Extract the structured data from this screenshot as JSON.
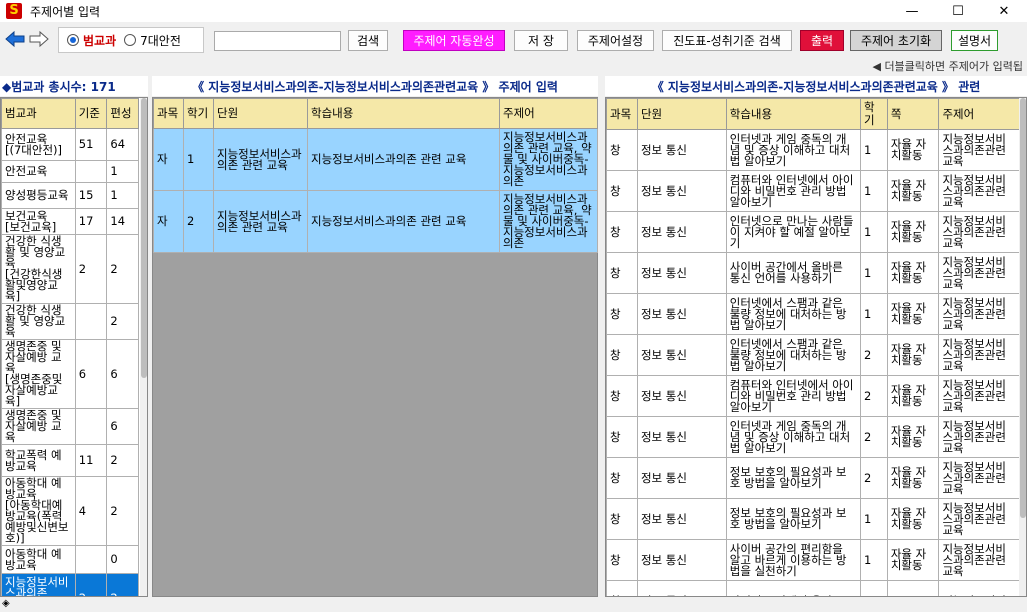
{
  "window": {
    "title": "주제어별 입력",
    "app_icon": "S"
  },
  "toolbar": {
    "radio_1": "범교과",
    "radio_2": "7대안전",
    "search_value": "",
    "search_btn": "검색",
    "auto_btn": "주제어 자동완성",
    "save_btn": "저 장",
    "settings_btn": "주제어설정",
    "progress_btn": "진도표-성취기준 검색",
    "print_btn": "출력",
    "reset_btn": "주제어 초기화",
    "manual_btn": "설명서"
  },
  "hint": "◀ 더블클릭하면 주제어가 입력됩",
  "left_panel": {
    "header": "◆범교과 총시수: 171",
    "columns": [
      "범교과",
      "기준",
      "편성"
    ],
    "rows": [
      {
        "name": "안전교육\n[(7대안전)]",
        "base": "51",
        "plan": "64"
      },
      {
        "name": "안전교육",
        "base": "",
        "plan": "1"
      },
      {
        "name": "양성평등교육",
        "base": "15",
        "plan": "1"
      },
      {
        "name": "보건교육\n[보건교육]",
        "base": "17",
        "plan": "14"
      },
      {
        "name": "건강한 식생활 및 영양교육\n[건강한식생활및영양교육]",
        "base": "2",
        "plan": "2"
      },
      {
        "name": "건강한 식생활 및 영양교육",
        "base": "",
        "plan": "2"
      },
      {
        "name": "생명존중 및 자살예방 교육\n[생명존중및자살예방교육]",
        "base": "6",
        "plan": "6"
      },
      {
        "name": "생명존중 및 자살예방 교육",
        "base": "",
        "plan": "6"
      },
      {
        "name": "학교폭력 예방교육",
        "base": "11",
        "plan": "2"
      },
      {
        "name": "아동학대 예방교육\n[아동학대예방교육(폭력예방및신변보호)]",
        "base": "4",
        "plan": "2"
      },
      {
        "name": "아동학대 예방교육",
        "base": "",
        "plan": "0"
      },
      {
        "name": "지능정보서비스과의존\n[지능정보서비스과의존",
        "base": "2",
        "plan": "2"
      }
    ]
  },
  "mid_panel": {
    "header": "《 지능정보서비스과의존-지능정보서비스과의존관련교육 》 주제어 입력",
    "columns": [
      "과목",
      "학기",
      "단원",
      "학습내용",
      "주제어"
    ],
    "rows": [
      {
        "subject": "자",
        "term": "1",
        "unit": "지능정보서비스과의존 관련 교육",
        "content": "지능정보서비스과의존 관련 교육",
        "keyword": "지능정보서비스과의존 관련 교육, 약물 및 사이버중독-지능정보서비스과의존"
      },
      {
        "subject": "자",
        "term": "2",
        "unit": "지능정보서비스과의존 관련 교육",
        "content": "지능정보서비스과의존 관련 교육",
        "keyword": "지능정보서비스과의존 관련 교육, 약물 및 사이버중독-지능정보서비스과의존"
      }
    ]
  },
  "right_panel": {
    "header": "《 지능정보서비스과의존-지능정보서비스과의존관련교육 》 관련",
    "columns": [
      "과목",
      "단원",
      "학습내용",
      "학기",
      "쪽",
      "주제어"
    ],
    "rows": [
      {
        "subject": "창",
        "unit": "정보 통신",
        "content": "인터넷과 게임 중독의 개념 및 증상 이해하고 대처법 알아보기",
        "term": "1",
        "page": "자율 자치활동",
        "keyword": "지능정보서비스과의존관련교육"
      },
      {
        "subject": "창",
        "unit": "정보 통신",
        "content": "컴퓨터와 인터넷에서 아이디와 비밀번호 관리 방법 알아보기",
        "term": "1",
        "page": "자율 자치활동",
        "keyword": "지능정보서비스과의존관련교육"
      },
      {
        "subject": "창",
        "unit": "정보 통신",
        "content": "인터넷으로 만나는 사람들이 지켜야 할 예절 알아보기",
        "term": "1",
        "page": "자율 자치활동",
        "keyword": "지능정보서비스과의존관련교육"
      },
      {
        "subject": "창",
        "unit": "정보 통신",
        "content": "사이버 공간에서 올바른 통신 언어를 사용하기",
        "term": "1",
        "page": "자율 자치활동",
        "keyword": "지능정보서비스과의존관련교육"
      },
      {
        "subject": "창",
        "unit": "정보 통신",
        "content": "인터넷에서 스팸과 같은 불량 정보에 대처하는 방법 알아보기",
        "term": "1",
        "page": "자율 자치활동",
        "keyword": "지능정보서비스과의존관련교육"
      },
      {
        "subject": "창",
        "unit": "정보 통신",
        "content": "인터넷에서 스팸과 같은 불량 정보에 대처하는 방법 알아보기",
        "term": "2",
        "page": "자율 자치활동",
        "keyword": "지능정보서비스과의존관련교육"
      },
      {
        "subject": "창",
        "unit": "정보 통신",
        "content": "컴퓨터와 인터넷에서 아이디와 비밀번호 관리 방법 알아보기",
        "term": "2",
        "page": "자율 자치활동",
        "keyword": "지능정보서비스과의존관련교육"
      },
      {
        "subject": "창",
        "unit": "정보 통신",
        "content": "인터넷과 게임 중독의 개념 및 증상 이해하고 대처법 알아보기",
        "term": "2",
        "page": "자율 자치활동",
        "keyword": "지능정보서비스과의존관련교육"
      },
      {
        "subject": "창",
        "unit": "정보 통신",
        "content": "정보 보호의 필요성과 보호 방법을 알아보기",
        "term": "2",
        "page": "자율 자치활동",
        "keyword": "지능정보서비스과의존관련교육"
      },
      {
        "subject": "창",
        "unit": "정보 통신",
        "content": "정보 보호의 필요성과 보호 방법을 알아보기",
        "term": "1",
        "page": "자율 자치활동",
        "keyword": "지능정보서비스과의존관련교육"
      },
      {
        "subject": "창",
        "unit": "정보 통신",
        "content": "사이버 공간의 편리함을 알고 바르게 이용하는 방법을 실천하기",
        "term": "1",
        "page": "자율 자치활동",
        "keyword": "지능정보서비스과의존관련교육"
      },
      {
        "subject": "창",
        "unit": "정보 통신",
        "content": "사이버 공간에서 올바",
        "term": "",
        "page": "",
        "keyword": "지능정보서비"
      }
    ]
  },
  "status": "◈",
  "colors": {
    "selected_row": "#0a78d7",
    "matched_row": "#99d4ff",
    "header_bg": "#f5e8a8",
    "panel_title": "#0a2a8a"
  }
}
